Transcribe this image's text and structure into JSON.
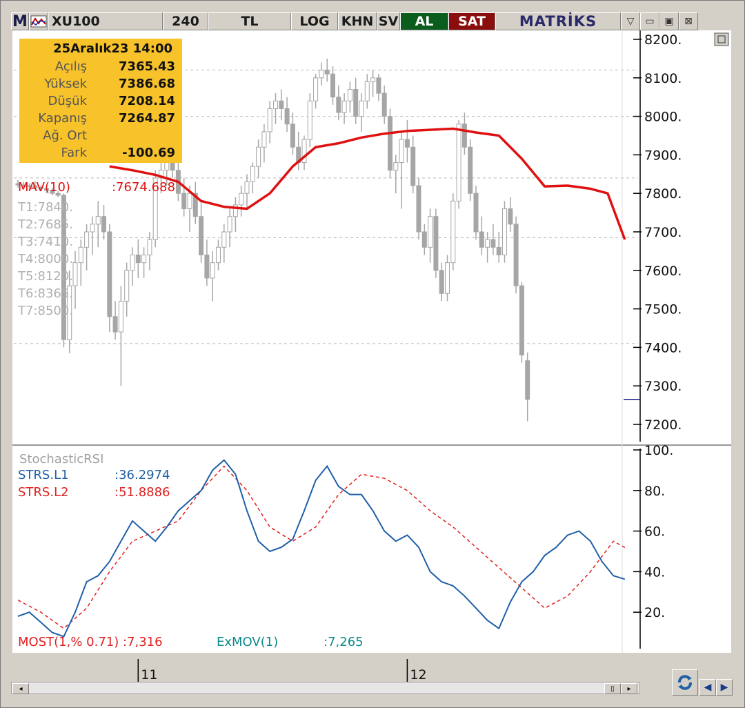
{
  "toolbar": {
    "menu_label": "M",
    "symbol": "XU100",
    "period": "240",
    "currency": "TL",
    "log_label": "LOG",
    "khn_label": "KHN",
    "sv_label": "SV",
    "buy_label": "AL",
    "sell_label": "SAT",
    "brand": "MATRİKS",
    "dropdown_icon": "chevron-down-icon",
    "min_icon": "minimize-icon",
    "max_icon": "maximize-icon",
    "close_icon": "close-icon"
  },
  "info": {
    "date": "25Aralık23 14:00",
    "rows": [
      {
        "k": "Açılış",
        "v": "7365.43"
      },
      {
        "k": "Yüksek",
        "v": "7386.68"
      },
      {
        "k": "Düşük",
        "v": "7208.14"
      },
      {
        "k": "Kapanış",
        "v": "7264.87"
      },
      {
        "k": "Ağ. Ort",
        "v": ""
      },
      {
        "k": "Fark",
        "v": "-100.69"
      }
    ]
  },
  "indicators": {
    "mav_label": "MAV(10)",
    "mav_value": ":7674.688",
    "targets": [
      "T1:7840.",
      "T2:7685.",
      "T3:7410.",
      "T4:8000.",
      "T5:8120.",
      "T6:8365.",
      "T7:8500."
    ],
    "stoch_title": "StochasticRSI",
    "l1_label": "STRS.L1",
    "l1_value": ":36.2974",
    "l2_label": "STRS.L2",
    "l2_value": ":51.8886",
    "most_label": "MOST(1,% 0.71) :7,316",
    "exmov_label": "ExMOV(1)",
    "exmov_value": ":7,265"
  },
  "colors": {
    "candle": "#a6a6a6",
    "mav": "#e01010",
    "l1": "#1f5fa8",
    "l2": "#e02020",
    "exmov": "#0e8a8a",
    "grid": "#b8b8b8"
  },
  "chart_data": [
    {
      "type": "candlestick",
      "title": "XU100",
      "ylim": [
        7160,
        8220
      ],
      "yticks": [
        "8200.",
        "8100.",
        "8000.",
        "7900.",
        "7800.",
        "7700.",
        "7600.",
        "7500.",
        "7400.",
        "7300.",
        "7200."
      ],
      "ytick_values": [
        8200,
        8100,
        8000,
        7900,
        7800,
        7700,
        7600,
        7500,
        7400,
        7300,
        7200
      ],
      "hlines": [
        8120,
        8000,
        7840,
        7685,
        7410
      ],
      "last_price": 7264.87,
      "x_labels": [
        {
          "label": "11",
          "index": 21
        },
        {
          "label": "12",
          "index": 68
        }
      ],
      "ohlc": [
        [
          7825,
          7835,
          7815,
          7822
        ],
        [
          7822,
          7830,
          7810,
          7818
        ],
        [
          7818,
          7826,
          7808,
          7820
        ],
        [
          7820,
          7832,
          7810,
          7815
        ],
        [
          7815,
          7820,
          7805,
          7812
        ],
        [
          7812,
          7818,
          7800,
          7808
        ],
        [
          7808,
          7814,
          7795,
          7800
        ],
        [
          7800,
          7806,
          7790,
          7795
        ],
        [
          7795,
          7800,
          7400,
          7420
        ],
        [
          7420,
          7600,
          7385,
          7560
        ],
        [
          7560,
          7650,
          7500,
          7620
        ],
        [
          7620,
          7680,
          7560,
          7660
        ],
        [
          7660,
          7720,
          7600,
          7700
        ],
        [
          7700,
          7740,
          7640,
          7720
        ],
        [
          7720,
          7780,
          7660,
          7740
        ],
        [
          7740,
          7770,
          7680,
          7700
        ],
        [
          7700,
          7720,
          7440,
          7480
        ],
        [
          7480,
          7520,
          7420,
          7440
        ],
        [
          7440,
          7560,
          7300,
          7520
        ],
        [
          7520,
          7620,
          7480,
          7600
        ],
        [
          7600,
          7660,
          7560,
          7640
        ],
        [
          7640,
          7680,
          7580,
          7620
        ],
        [
          7620,
          7660,
          7580,
          7640
        ],
        [
          7640,
          7700,
          7600,
          7680
        ],
        [
          7680,
          7860,
          7660,
          7840
        ],
        [
          7840,
          7900,
          7800,
          7860
        ],
        [
          7860,
          7910,
          7820,
          7880
        ],
        [
          7880,
          7920,
          7840,
          7860
        ],
        [
          7860,
          7880,
          7780,
          7800
        ],
        [
          7800,
          7840,
          7740,
          7760
        ],
        [
          7760,
          7820,
          7700,
          7800
        ],
        [
          7800,
          7830,
          7720,
          7740
        ],
        [
          7740,
          7780,
          7620,
          7640
        ],
        [
          7640,
          7680,
          7560,
          7580
        ],
        [
          7580,
          7650,
          7520,
          7620
        ],
        [
          7620,
          7680,
          7600,
          7660
        ],
        [
          7660,
          7720,
          7620,
          7700
        ],
        [
          7700,
          7760,
          7660,
          7740
        ],
        [
          7740,
          7790,
          7700,
          7770
        ],
        [
          7770,
          7820,
          7740,
          7800
        ],
        [
          7800,
          7850,
          7760,
          7830
        ],
        [
          7830,
          7880,
          7800,
          7870
        ],
        [
          7870,
          7940,
          7840,
          7920
        ],
        [
          7920,
          7980,
          7880,
          7960
        ],
        [
          7960,
          8040,
          7930,
          8020
        ],
        [
          8020,
          8060,
          7980,
          8040
        ],
        [
          8040,
          8070,
          7990,
          8020
        ],
        [
          8020,
          8050,
          7960,
          7980
        ],
        [
          7980,
          8010,
          7900,
          7920
        ],
        [
          7920,
          7960,
          7860,
          7880
        ],
        [
          7880,
          7950,
          7860,
          7940
        ],
        [
          7940,
          8060,
          7920,
          8040
        ],
        [
          8040,
          8110,
          8020,
          8100
        ],
        [
          8100,
          8140,
          8080,
          8120
        ],
        [
          8120,
          8150,
          8090,
          8110
        ],
        [
          8110,
          8130,
          8030,
          8050
        ],
        [
          8050,
          8080,
          7990,
          8010
        ],
        [
          8010,
          8060,
          7980,
          8040
        ],
        [
          8040,
          8090,
          8010,
          8070
        ],
        [
          8070,
          8100,
          7980,
          8000
        ],
        [
          8000,
          8060,
          7960,
          8040
        ],
        [
          8040,
          8110,
          8020,
          8090
        ],
        [
          8090,
          8120,
          8050,
          8100
        ],
        [
          8100,
          8110,
          8040,
          8060
        ],
        [
          8060,
          8080,
          7980,
          8000
        ],
        [
          8000,
          8020,
          7840,
          7860
        ],
        [
          7860,
          7900,
          7800,
          7880
        ],
        [
          7880,
          7960,
          7760,
          7940
        ],
        [
          7940,
          7990,
          7880,
          7920
        ],
        [
          7920,
          7950,
          7800,
          7820
        ],
        [
          7820,
          7840,
          7680,
          7700
        ],
        [
          7700,
          7720,
          7640,
          7660
        ],
        [
          7660,
          7760,
          7620,
          7740
        ],
        [
          7740,
          7760,
          7580,
          7600
        ],
        [
          7600,
          7620,
          7520,
          7540
        ],
        [
          7540,
          7640,
          7520,
          7620
        ],
        [
          7620,
          7800,
          7600,
          7780
        ],
        [
          7780,
          7990,
          7760,
          7980
        ],
        [
          7980,
          8010,
          7900,
          7920
        ],
        [
          7920,
          7940,
          7780,
          7800
        ],
        [
          7800,
          7820,
          7680,
          7700
        ],
        [
          7700,
          7740,
          7640,
          7660
        ],
        [
          7660,
          7700,
          7620,
          7680
        ],
        [
          7680,
          7720,
          7640,
          7660
        ],
        [
          7660,
          7700,
          7620,
          7640
        ],
        [
          7640,
          7780,
          7620,
          7760
        ],
        [
          7760,
          7790,
          7700,
          7720
        ],
        [
          7720,
          7740,
          7540,
          7560
        ],
        [
          7560,
          7570,
          7360,
          7380
        ],
        [
          7365.43,
          7386.68,
          7208.14,
          7264.87
        ]
      ],
      "mav": [
        [
          16,
          7870
        ],
        [
          20,
          7860
        ],
        [
          24,
          7848
        ],
        [
          28,
          7830
        ],
        [
          32,
          7780
        ],
        [
          36,
          7765
        ],
        [
          40,
          7760
        ],
        [
          44,
          7800
        ],
        [
          48,
          7870
        ],
        [
          52,
          7920
        ],
        [
          56,
          7930
        ],
        [
          60,
          7945
        ],
        [
          64,
          7955
        ],
        [
          68,
          7962
        ],
        [
          72,
          7965
        ],
        [
          76,
          7968
        ],
        [
          80,
          7958
        ],
        [
          84,
          7950
        ],
        [
          88,
          7890
        ],
        [
          92,
          7818
        ],
        [
          96,
          7820
        ],
        [
          100,
          7812
        ],
        [
          103,
          7800
        ],
        [
          106,
          7680
        ]
      ],
      "mav_last": 7674.688
    },
    {
      "type": "line",
      "title": "StochasticRSI",
      "ylim": [
        0,
        100
      ],
      "yticks": [
        "100.",
        "80.",
        "60.",
        "40.",
        "20."
      ],
      "ytick_values": [
        100,
        80,
        60,
        40,
        20
      ],
      "series": [
        {
          "name": "STRS.L1",
          "x": [
            0,
            2,
            4,
            6,
            8,
            10,
            12,
            14,
            16,
            18,
            20,
            22,
            24,
            26,
            28,
            30,
            32,
            34,
            36,
            38,
            40,
            42,
            44,
            46,
            48,
            50,
            52,
            54,
            56,
            58,
            60,
            62,
            64,
            66,
            68,
            70,
            72,
            74,
            76,
            78,
            80,
            82,
            84,
            86,
            88,
            90,
            92,
            94,
            96,
            98,
            100,
            102,
            104,
            106
          ],
          "values": [
            18,
            20,
            15,
            10,
            8,
            20,
            35,
            38,
            45,
            55,
            65,
            60,
            55,
            62,
            70,
            75,
            80,
            90,
            95,
            88,
            70,
            55,
            50,
            52,
            56,
            70,
            85,
            92,
            82,
            78,
            78,
            70,
            60,
            55,
            58,
            52,
            40,
            35,
            33,
            28,
            22,
            16,
            12,
            25,
            35,
            40,
            48,
            52,
            58,
            60,
            55,
            45,
            38,
            36.2974
          ]
        },
        {
          "name": "STRS.L2",
          "x": [
            0,
            4,
            8,
            12,
            16,
            20,
            24,
            28,
            32,
            36,
            40,
            44,
            48,
            52,
            56,
            60,
            64,
            68,
            72,
            76,
            80,
            84,
            88,
            92,
            96,
            100,
            104,
            106
          ],
          "values": [
            26,
            20,
            12,
            22,
            40,
            55,
            60,
            65,
            80,
            92,
            80,
            62,
            55,
            62,
            78,
            88,
            86,
            80,
            70,
            62,
            52,
            42,
            32,
            22,
            28,
            40,
            55,
            51.8886
          ]
        }
      ],
      "l1_last": 36.2974,
      "l2_last": 51.8886
    }
  ]
}
